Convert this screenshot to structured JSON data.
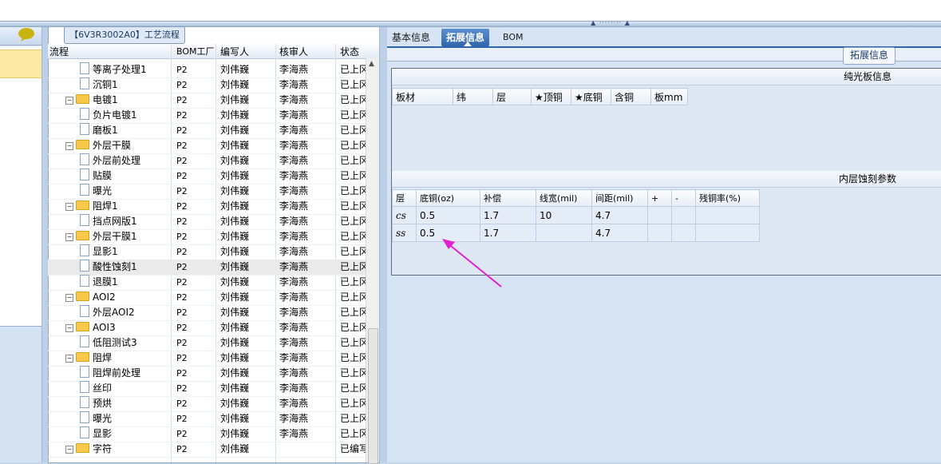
{
  "tree_panel": {
    "title": "【6V3R3002A0】工艺流程",
    "columns": [
      "流程",
      "BOM工厂",
      "编写人",
      "核审人",
      "状态"
    ],
    "rows": [
      {
        "indent": 2,
        "kind": "file",
        "name": "等离子处理1",
        "plant": "P2",
        "writer": "刘伟巍",
        "auditor": "李海燕",
        "status": "已上冈"
      },
      {
        "indent": 2,
        "kind": "file",
        "name": "沉铜1",
        "plant": "P2",
        "writer": "刘伟巍",
        "auditor": "李海燕",
        "status": "已上冈"
      },
      {
        "indent": 1,
        "kind": "folder",
        "name": "电镀1",
        "plant": "P2",
        "writer": "刘伟巍",
        "auditor": "李海燕",
        "status": "已上冈"
      },
      {
        "indent": 2,
        "kind": "file",
        "name": "负片电镀1",
        "plant": "P2",
        "writer": "刘伟巍",
        "auditor": "李海燕",
        "status": "已上冈"
      },
      {
        "indent": 2,
        "kind": "file",
        "name": "磨板1",
        "plant": "P2",
        "writer": "刘伟巍",
        "auditor": "李海燕",
        "status": "已上冈"
      },
      {
        "indent": 1,
        "kind": "folder",
        "name": "外层干膜",
        "plant": "P2",
        "writer": "刘伟巍",
        "auditor": "李海燕",
        "status": "已上冈"
      },
      {
        "indent": 2,
        "kind": "file",
        "name": "外层前处理",
        "plant": "P2",
        "writer": "刘伟巍",
        "auditor": "李海燕",
        "status": "已上冈"
      },
      {
        "indent": 2,
        "kind": "file",
        "name": "贴膜",
        "plant": "P2",
        "writer": "刘伟巍",
        "auditor": "李海燕",
        "status": "已上冈"
      },
      {
        "indent": 2,
        "kind": "file",
        "name": "曝光",
        "plant": "P2",
        "writer": "刘伟巍",
        "auditor": "李海燕",
        "status": "已上冈"
      },
      {
        "indent": 1,
        "kind": "folder",
        "name": "阻焊1",
        "plant": "P2",
        "writer": "刘伟巍",
        "auditor": "李海燕",
        "status": "已上冈"
      },
      {
        "indent": 2,
        "kind": "file",
        "name": "挡点网版1",
        "plant": "P2",
        "writer": "刘伟巍",
        "auditor": "李海燕",
        "status": "已上冈"
      },
      {
        "indent": 1,
        "kind": "folder",
        "name": "外层干膜1",
        "plant": "P2",
        "writer": "刘伟巍",
        "auditor": "李海燕",
        "status": "已上冈"
      },
      {
        "indent": 2,
        "kind": "file",
        "name": "显影1",
        "plant": "P2",
        "writer": "刘伟巍",
        "auditor": "李海燕",
        "status": "已上冈"
      },
      {
        "indent": 2,
        "kind": "file",
        "name": "酸性蚀刻1",
        "plant": "P2",
        "writer": "刘伟巍",
        "auditor": "李海燕",
        "status": "已上冈",
        "highlight": true
      },
      {
        "indent": 2,
        "kind": "file",
        "name": "退膜1",
        "plant": "P2",
        "writer": "刘伟巍",
        "auditor": "李海燕",
        "status": "已上冈"
      },
      {
        "indent": 1,
        "kind": "folder",
        "name": "AOI2",
        "plant": "P2",
        "writer": "刘伟巍",
        "auditor": "李海燕",
        "status": "已上冈"
      },
      {
        "indent": 2,
        "kind": "file",
        "name": "外层AOI2",
        "plant": "P2",
        "writer": "刘伟巍",
        "auditor": "李海燕",
        "status": "已上冈"
      },
      {
        "indent": 1,
        "kind": "folder",
        "name": "AOI3",
        "plant": "P2",
        "writer": "刘伟巍",
        "auditor": "李海燕",
        "status": "已上冈"
      },
      {
        "indent": 2,
        "kind": "file",
        "name": "低阻测试3",
        "plant": "P2",
        "writer": "刘伟巍",
        "auditor": "李海燕",
        "status": "已上冈"
      },
      {
        "indent": 1,
        "kind": "folder",
        "name": "阻焊",
        "plant": "P2",
        "writer": "刘伟巍",
        "auditor": "李海燕",
        "status": "已上冈"
      },
      {
        "indent": 2,
        "kind": "file",
        "name": "阻焊前处理",
        "plant": "P2",
        "writer": "刘伟巍",
        "auditor": "李海燕",
        "status": "已上冈"
      },
      {
        "indent": 2,
        "kind": "file",
        "name": "丝印",
        "plant": "P2",
        "writer": "刘伟巍",
        "auditor": "李海燕",
        "status": "已上冈"
      },
      {
        "indent": 2,
        "kind": "file",
        "name": "预烘",
        "plant": "P2",
        "writer": "刘伟巍",
        "auditor": "李海燕",
        "status": "已上冈"
      },
      {
        "indent": 2,
        "kind": "file",
        "name": "曝光",
        "plant": "P2",
        "writer": "刘伟巍",
        "auditor": "李海燕",
        "status": "已上冈"
      },
      {
        "indent": 2,
        "kind": "file",
        "name": "显影",
        "plant": "P2",
        "writer": "刘伟巍",
        "auditor": "李海燕",
        "status": "已上冈"
      },
      {
        "indent": 1,
        "kind": "folder",
        "name": "字符",
        "plant": "P2",
        "writer": "刘伟巍",
        "auditor": "",
        "status": "已编写"
      }
    ]
  },
  "right_panel": {
    "tabs": [
      "基本信息",
      "拓展信息",
      "BOM"
    ],
    "active_tab": 1,
    "subtab": "拓展信息",
    "board_section": {
      "title": "纯光板信息",
      "columns": [
        "板材",
        "纬",
        "层",
        "★顶铜",
        "★底铜",
        "含铜",
        "板mm"
      ]
    },
    "etch_section": {
      "title": "内层蚀刻参数",
      "columns": [
        "层",
        "底铜(oz)",
        "补偿",
        "线宽(mil)",
        "间距(mil)",
        "+",
        "-",
        "残铜率(%)"
      ],
      "rows": [
        [
          "cs",
          "0.5",
          "1.7",
          "10",
          "4.7",
          "",
          "",
          ""
        ],
        [
          "ss",
          "0.5",
          "1.7",
          "",
          "4.7",
          "",
          "",
          ""
        ]
      ]
    }
  },
  "colors": {
    "accent": "#2f65ad",
    "annotation_arrow": "#e020d0",
    "selected_row": "#eaeaea"
  }
}
